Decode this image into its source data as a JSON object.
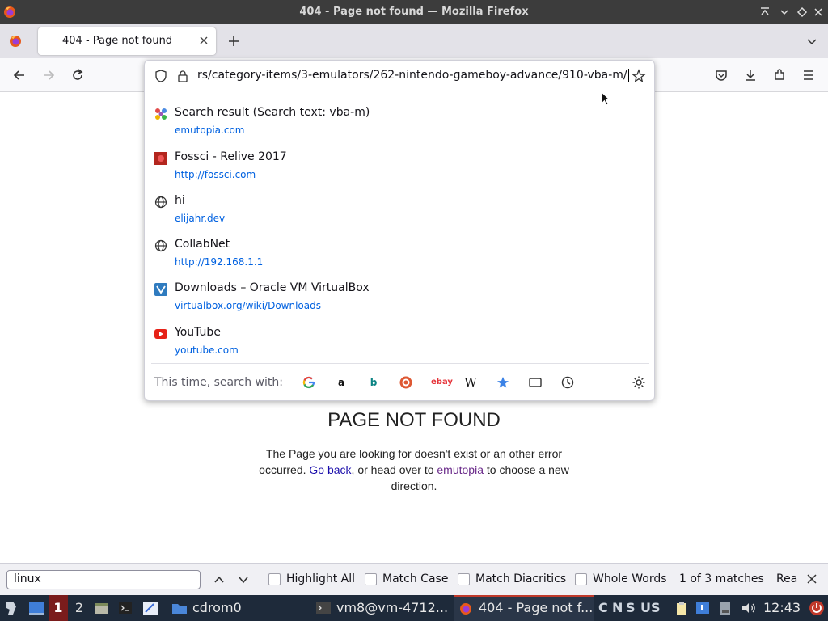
{
  "window": {
    "title": "404 - Page not found — Mozilla Firefox"
  },
  "tabs": [
    {
      "label": "404 - Page not found"
    }
  ],
  "urlbar": {
    "value": "rs/category-items/3-emulators/262-nintendo-gameboy-advance/910-vba-m/"
  },
  "suggestions": [
    {
      "title": "Search result (Search text: vba-m)",
      "url": "emutopia.com",
      "icon": "emutopia-icon"
    },
    {
      "title": "Fossci - Relive 2017",
      "url": "http://fossci.com",
      "icon": "fossci-icon"
    },
    {
      "title": "hi",
      "url": "elijahr.dev",
      "icon": "globe-icon"
    },
    {
      "title": "CollabNet",
      "url": "http://192.168.1.1",
      "icon": "globe-icon"
    },
    {
      "title": "Downloads – Oracle VM VirtualBox",
      "url": "virtualbox.org/wiki/Downloads",
      "icon": "virtualbox-icon"
    },
    {
      "title": "YouTube",
      "url": "youtube.com",
      "icon": "youtube-icon"
    }
  ],
  "onesearch": {
    "label": "This time, search with:",
    "engines": [
      "google-icon",
      "amazon-icon",
      "bing-icon",
      "duckduckgo-icon",
      "ebay-icon",
      "wikipedia-icon",
      "bookmarks-icon",
      "tabs-icon",
      "history-icon"
    ]
  },
  "page": {
    "heading": "PAGE NOT FOUND",
    "text_before": "The Page you are looking for doesn't exist or an other error occurred. ",
    "link1": "Go back",
    "text_middle": ", or head over to ",
    "link2": "emutopia",
    "text_after": " to choose a new direction."
  },
  "findbar": {
    "query": "linux",
    "highlight_all": "Highlight All",
    "match_case": "Match Case",
    "match_diacritics": "Match Diacritics",
    "whole_words": "Whole Words",
    "matches": "1 of 3 matches",
    "truncated": "Rea"
  },
  "taskbar": {
    "workspace_active": "1",
    "workspace_2": "2",
    "folder_label": "cdrom0",
    "terminal_label": "vm8@vm-4712...",
    "firefox_label": "404 - Page not f...",
    "tray_letters": [
      "C",
      "N",
      "S"
    ],
    "keyboard_layout": "US",
    "clock": "12:43"
  },
  "colors": {
    "accent": "#0061e0",
    "taskbar_bg": "#1e2a3a",
    "titlebar_bg": "#3c3c3c",
    "workspace_active": "#7a1c1c"
  }
}
